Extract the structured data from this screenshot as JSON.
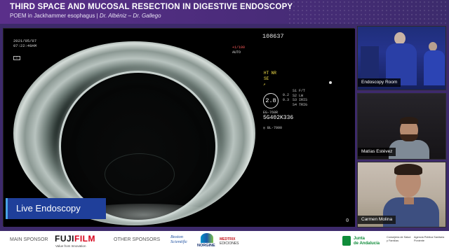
{
  "header": {
    "title": "THIRD SPACE AND MUCOSAL RESECTION IN DIGESTIVE ENDOSCOPY",
    "subtitle_main": "POEM in Jackhammer esophagus | ",
    "subtitle_authors": "Dr. Albéniz – Dr. Gallego"
  },
  "endoscope": {
    "date": "2021/05/07",
    "time": "07:22:49AM",
    "zoom_line1": "+1/100",
    "zoom_line2": "AUTO",
    "small_icon": "C",
    "patient_id": "108637",
    "mode_line1": "HT NR",
    "mode_line2": "SE",
    "mode_line3": "↗",
    "hex_value": "2.8",
    "nums_line1": "0.2",
    "nums_line2": "0.3",
    "labels": [
      "S1 F/T",
      "S2 LW",
      "S3 IRIS",
      "S4 TRIG"
    ],
    "scope_model": "EG-760R",
    "serial": "5G402K336",
    "processor": "BL-7000",
    "counter": "0"
  },
  "live_badge": "Live Endoscopy",
  "cameras": [
    {
      "label": "Endoscopy Room"
    },
    {
      "label": "Matías Estévez"
    },
    {
      "label": "Carmen Molina"
    }
  ],
  "footer": {
    "main_sponsor_label": "MAIN SPONSOR",
    "fujifilm_a": "FUJI",
    "fujifilm_b": "FILM",
    "fujifilm_tag": "Value from Innovation",
    "other_sponsors_label": "OTHER SPONSORS",
    "boston_a": "Boston",
    "boston_b": "Scientific",
    "norgine": "NORGINE",
    "medtrix_a": "MEDTRIX",
    "medtrix_b": "EDICIONES",
    "junta_a": "Junta",
    "junta_b": "de Andalucía",
    "consejeria_a": "Consejería de Salud",
    "consejeria_b": "y Familias",
    "agencia_a": "Agencia Pública Sanitaria",
    "agencia_b": "Poniente"
  }
}
